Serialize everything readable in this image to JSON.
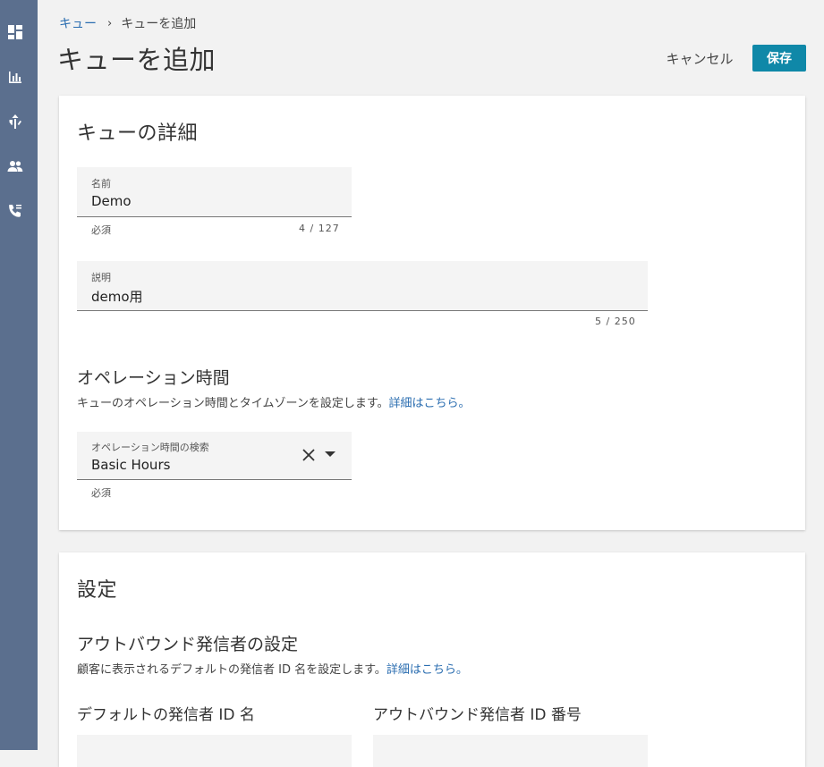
{
  "sidebar": {
    "icons": [
      "dashboard-icon",
      "analytics-icon",
      "routing-icon",
      "users-icon",
      "phone-icon"
    ]
  },
  "breadcrumb": {
    "parent": "キュー",
    "separator": "›",
    "current": "キューを追加"
  },
  "page": {
    "title": "キューを追加",
    "cancel_label": "キャンセル",
    "save_label": "保存"
  },
  "queue_details": {
    "title": "キューの詳細",
    "name_field": {
      "label": "名前",
      "value": "Demo",
      "hint": "必須",
      "counter": "4 / 127"
    },
    "description_field": {
      "label": "説明",
      "value": "demo用",
      "counter": "5 / 250"
    }
  },
  "operation_hours": {
    "title": "オペレーション時間",
    "description": "キューのオペレーション時間とタイムゾーンを設定します。",
    "link": "詳細はこちら。",
    "search_field": {
      "label": "オペレーション時間の検索",
      "value": "Basic Hours",
      "hint": "必須"
    }
  },
  "settings": {
    "title": "設定",
    "outbound": {
      "title": "アウトバウンド発信者の設定",
      "description": "顧客に表示されるデフォルトの発信者 ID 名を設定します。",
      "link": "詳細はこちら。",
      "default_caller_id_name_label": "デフォルトの発信者 ID 名",
      "outbound_caller_id_number_label": "アウトバウンド発信者 ID 番号"
    }
  },
  "colors": {
    "sidebar": "#5b6f8e",
    "accent": "#0f88a8",
    "link": "#2a6db0"
  }
}
